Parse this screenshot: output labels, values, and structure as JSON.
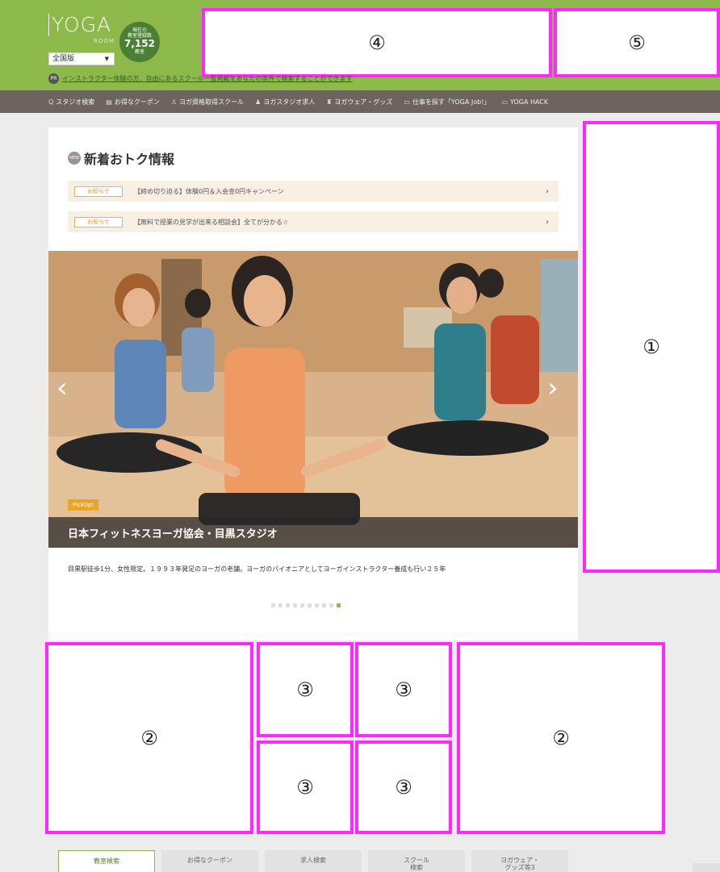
{
  "header": {
    "logo": "YOGA",
    "logo_sub": "ROOM",
    "region": "全国版",
    "count_label": "現在の\n教室登録数",
    "count_value": "7,152",
    "count_unit": "教室",
    "pr_badge": "PR",
    "pr_text": "インストラクター体験の方、自由にあるスクール一覧掲載をあなたの条件で検索することができます"
  },
  "nav": [
    {
      "icon": "search-icon",
      "glyph": "Q",
      "label": "スタジオ検索"
    },
    {
      "icon": "coupon-icon",
      "glyph": "▤",
      "label": "お得なクーポン"
    },
    {
      "icon": "certificate-icon",
      "glyph": "♙",
      "label": "ヨガ資格取得スクール"
    },
    {
      "icon": "person-icon",
      "glyph": "♟",
      "label": "ヨガスタジオ求人"
    },
    {
      "icon": "shirt-icon",
      "glyph": "♜",
      "label": "ヨガウェア・グッズ"
    },
    {
      "icon": "job-icon",
      "glyph": "▭",
      "label": "仕事を探す「YOGA Job!」"
    },
    {
      "icon": "hack-icon",
      "glyph": "▭",
      "label": "YOGA HACK"
    }
  ],
  "annotations": {
    "a1": "①",
    "a2": "②",
    "a3": "③",
    "a4": "④",
    "a5": "⑤"
  },
  "news": {
    "badge": "NEW",
    "title": "新着おトク情報",
    "items": [
      {
        "tag": "お知らせ",
        "text": "【締め切り迫る】体験0円＆入会金0円キャンペーン"
      },
      {
        "tag": "お知らせ",
        "text": "【無料で授業の見学が出来る相談会】全てが分かる☆"
      }
    ]
  },
  "slider": {
    "pickup": "PickUp!",
    "caption": "日本フィットネスヨーガ協会・目黒スタジオ",
    "description": "目黒駅徒歩1分、女性限定。１９９３年発足のヨーガの老舗。ヨーガのパイオニアとしてヨーガインストラクター養成も行い２５年",
    "dot_count": 10,
    "active_dot": 9
  },
  "tabs": [
    {
      "label": "教室検索",
      "active": true
    },
    {
      "label": "お得なクーポン",
      "active": false
    },
    {
      "label": "求人検索",
      "active": false
    },
    {
      "label": "スクール\n検索",
      "active": false
    },
    {
      "label": "ヨガウェア・\nグッズ等3",
      "active": false
    }
  ],
  "colors": {
    "header_green": "#8db84a",
    "nav_gray": "#6d6460",
    "annotation_magenta": "#ff29ff",
    "pickup_orange": "#e9a52a"
  }
}
